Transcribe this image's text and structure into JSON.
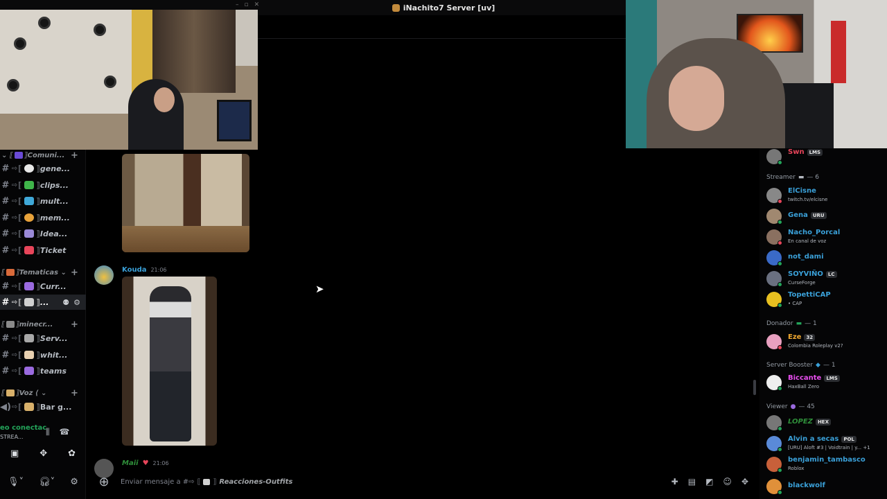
{
  "window": {
    "title": "iNachito7 Server [uv]"
  },
  "sidebar": {
    "categories": [
      {
        "label": "Comuni..."
      },
      {
        "label": "Tematicas"
      },
      {
        "label": "minecr..."
      },
      {
        "label": "Voz"
      }
    ],
    "channels": [
      {
        "name": "gene..."
      },
      {
        "name": "clips..."
      },
      {
        "name": "mult..."
      },
      {
        "name": "mem..."
      },
      {
        "name": "Idea..."
      },
      {
        "name": "Ticket"
      },
      {
        "name": "Curr..."
      },
      {
        "name": "..."
      },
      {
        "name": "Serv..."
      },
      {
        "name": "whit..."
      },
      {
        "name": "teams"
      },
      {
        "name": "Bar g..."
      }
    ],
    "voice": {
      "status": "eo conectac",
      "channel": "STREA..."
    }
  },
  "chat": {
    "messages": [
      {
        "author": "Kouda",
        "time": "21:06"
      },
      {
        "author": "Maii",
        "time": "21:06"
      }
    ],
    "composer_placeholder": "Enviar mensaje a #⇨",
    "composer_channel": "Reacciones-Outfits"
  },
  "members": {
    "top": {
      "name": "Swn",
      "tag": "LMS"
    },
    "groups": [
      {
        "label": "Streamer",
        "count": "— 6"
      },
      {
        "label": "Donador",
        "count": "— 1"
      },
      {
        "label": "Server Booster",
        "count": "— 1"
      },
      {
        "label": "Viewer",
        "count": "— 45"
      }
    ],
    "streamers": [
      {
        "name": "ElCisne",
        "sub": "twitch.tv/elcisne",
        "color": "#3aa0d8"
      },
      {
        "name": "Gena",
        "tag": "URU",
        "color": "#3aa0d8"
      },
      {
        "name": "Nacho_Porcal",
        "sub": "En canal de voz",
        "color": "#3aa0d8"
      },
      {
        "name": "not_dami",
        "color": "#3aa0d8"
      },
      {
        "name": "SOYVIÑO",
        "tag": "LC",
        "sub": "CurseForge",
        "color": "#3aa0d8"
      },
      {
        "name": "TopettiCAP",
        "sub": "• CAP",
        "color": "#3aa0d8"
      }
    ],
    "donador": [
      {
        "name": "Eze",
        "tag": "32",
        "sub": "Colombia Roleplay v2?",
        "color": "#f0a830"
      }
    ],
    "booster": [
      {
        "name": "Biccante",
        "tag": "LMS",
        "sub": "HaxBall Zero",
        "color": "#e94ef0"
      }
    ],
    "viewers": [
      {
        "name": "LOPEZ",
        "tag": "HEX",
        "color": "#2f8f3a"
      },
      {
        "name": "Alvin a secas",
        "tag": "POL",
        "sub": "[URU] Aloft #3 | Voidtrain | y... +1",
        "color": "#3aa0d8"
      },
      {
        "name": "benjamin_tambasco",
        "sub": "Roblox",
        "color": "#3aa0d8"
      },
      {
        "name": "blackwolf",
        "color": "#3aa0d8"
      }
    ]
  },
  "colors": {
    "online": "#23a55a",
    "username": "#3aa0d8",
    "bg": "#000000"
  }
}
